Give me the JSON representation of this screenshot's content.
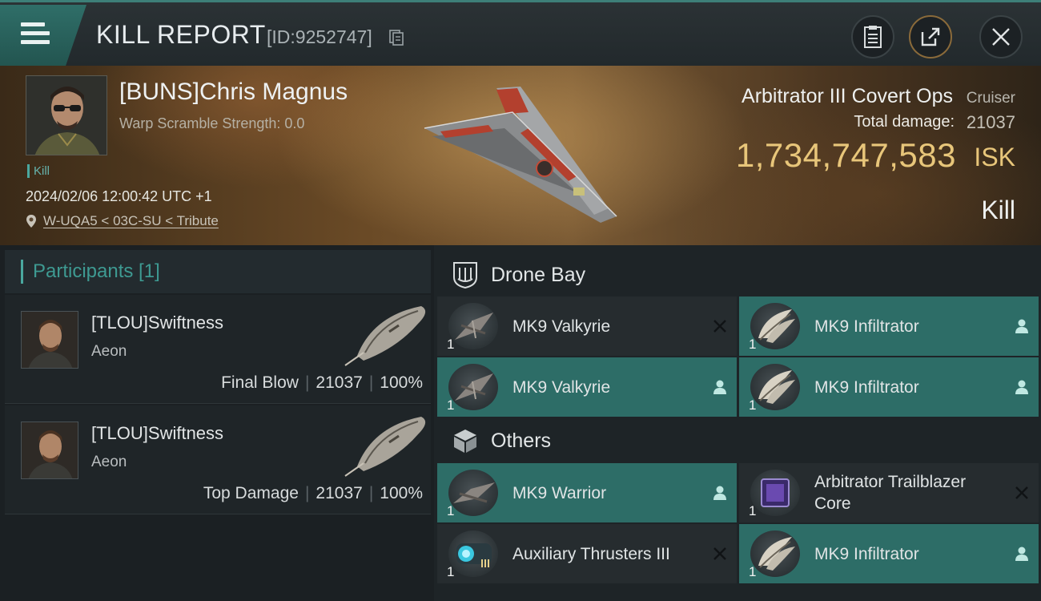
{
  "header": {
    "title": "KILL REPORT",
    "report_id": "[ID:9252747]"
  },
  "victim": {
    "name": "[BUNS]Chris Magnus",
    "warp_scramble": "Warp Scramble Strength: 0.0",
    "tag": "Kill",
    "datetime": "2024/02/06 12:00:42 UTC +1",
    "location": "W-UQA5 < 03C-SU < Tribute",
    "ship_name": "Arbitrator III Covert Ops",
    "ship_class": "Cruiser",
    "total_damage_label": "Total damage:",
    "total_damage": "21037",
    "isk_value": "1,734,747,583",
    "isk_unit": "ISK",
    "result": "Kill"
  },
  "participants": {
    "title": "Participants [1]",
    "items": [
      {
        "name": "[TLOU]Swiftness",
        "ship": "Aeon",
        "role": "Final Blow",
        "damage": "21037",
        "percent": "100%"
      },
      {
        "name": "[TLOU]Swiftness",
        "ship": "Aeon",
        "role": "Top Damage",
        "damage": "21037",
        "percent": "100%"
      }
    ]
  },
  "drone_bay": {
    "label": "Drone Bay",
    "items": [
      {
        "name": "MK9  Valkyrie",
        "qty": "1",
        "status": "destroyed"
      },
      {
        "name": "MK9  Infiltrator",
        "qty": "1",
        "status": "dropped"
      },
      {
        "name": "MK9  Valkyrie",
        "qty": "1",
        "status": "dropped"
      },
      {
        "name": "MK9  Infiltrator",
        "qty": "1",
        "status": "dropped"
      }
    ]
  },
  "others": {
    "label": "Others",
    "items": [
      {
        "name": "MK9  Warrior",
        "qty": "1",
        "status": "dropped"
      },
      {
        "name_line1": "Arbitrator Trailblazer",
        "name_line2": "Core",
        "qty": "1",
        "status": "destroyed"
      },
      {
        "name": "Auxiliary Thrusters III",
        "qty": "1",
        "status": "destroyed"
      },
      {
        "name": "MK9  Infiltrator",
        "qty": "1",
        "status": "dropped"
      }
    ]
  },
  "colors": {
    "accent_teal": "#2d6d67",
    "isk_gold": "#e8c67a",
    "header_bg": "#22292c"
  },
  "icons": [
    "menu-icon",
    "copy-icon",
    "clipboard-icon",
    "share-icon",
    "close-icon",
    "location-pin-icon",
    "drone-bay-icon",
    "cube-icon",
    "person-icon",
    "x-icon"
  ]
}
